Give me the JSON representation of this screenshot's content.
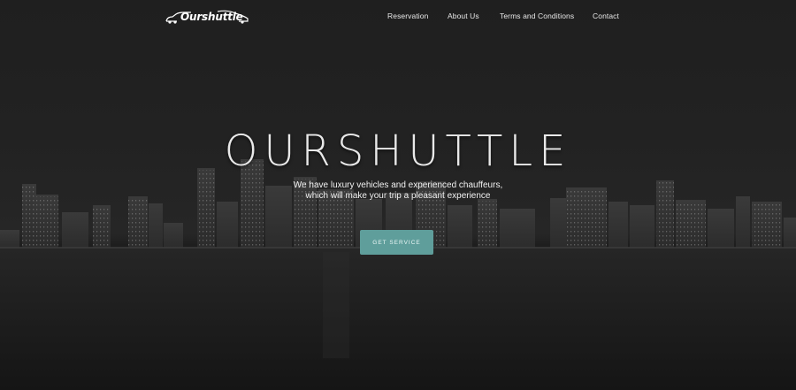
{
  "brand": {
    "name": "Ourshuttle"
  },
  "nav": {
    "items": [
      {
        "label": "Reservation"
      },
      {
        "label": "About Us"
      },
      {
        "label": "Terms and Conditions"
      },
      {
        "label": "Contact"
      }
    ]
  },
  "hero": {
    "title": "OURSHUTTLE",
    "subtitle": "We have luxury vehicles and experienced chauffeurs, which will make your trip a pleasant experience",
    "cta_label": "GET SERVICE"
  },
  "colors": {
    "accent": "#5f9e9b",
    "background": "#1f1f1f"
  }
}
